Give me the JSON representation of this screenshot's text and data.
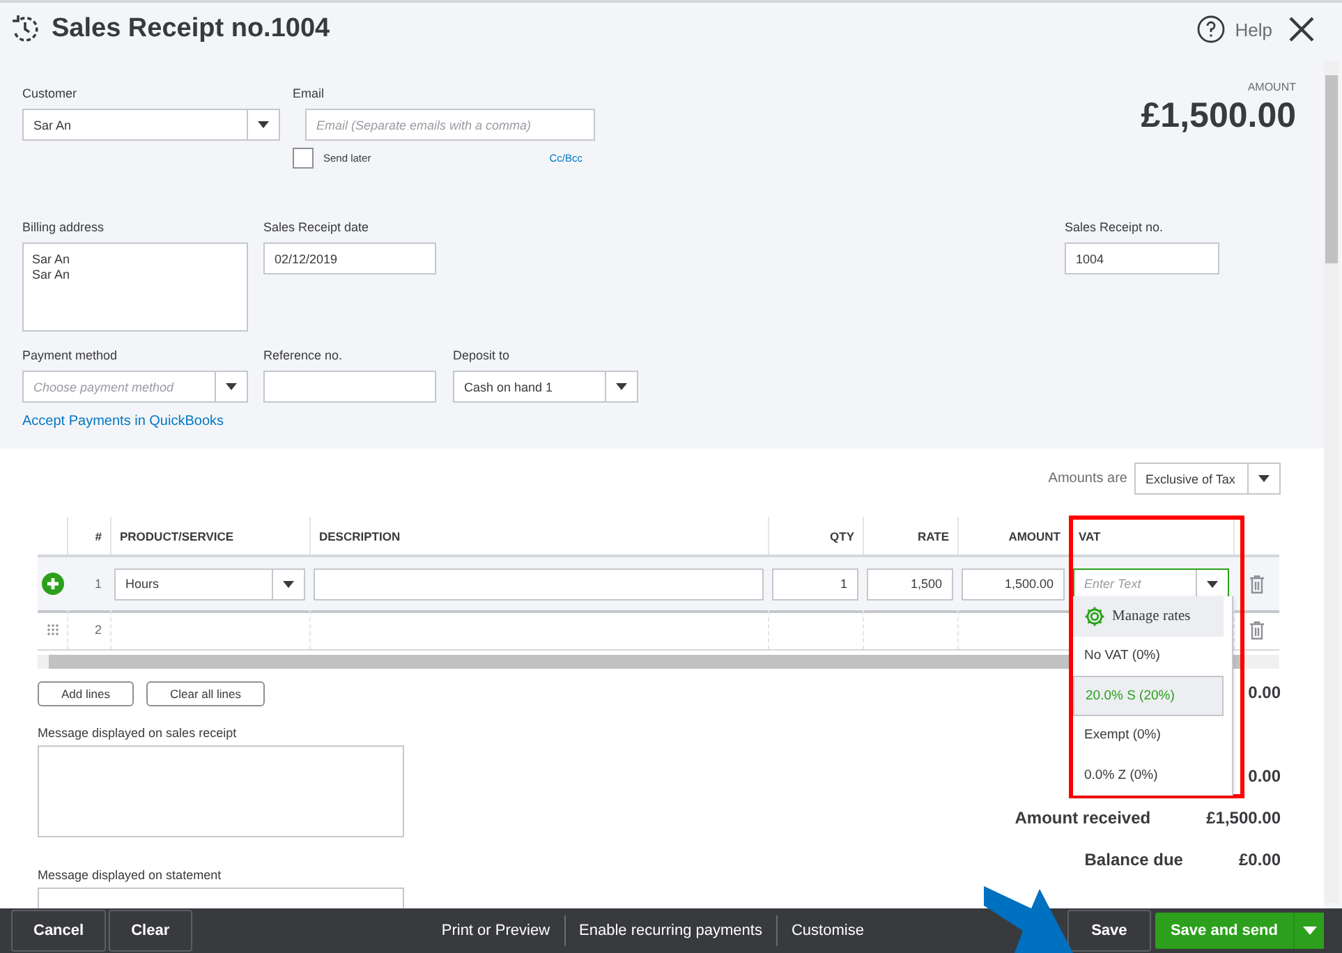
{
  "header": {
    "title": "Sales Receipt no.1004",
    "help": "Help"
  },
  "amount": {
    "label": "AMOUNT",
    "value": "£1,500.00"
  },
  "customer": {
    "label": "Customer",
    "value": "Sar An"
  },
  "email": {
    "label": "Email",
    "placeholder": "Email (Separate emails with a comma)"
  },
  "send_later": {
    "label": "Send later",
    "checked": false
  },
  "cc_bcc": "Cc/Bcc",
  "billing_address": {
    "label": "Billing address",
    "lines": [
      "Sar An",
      "Sar An"
    ]
  },
  "receipt_date": {
    "label": "Sales Receipt date",
    "value": "02/12/2019"
  },
  "receipt_no": {
    "label": "Sales Receipt no.",
    "value": "1004"
  },
  "payment_method": {
    "label": "Payment method",
    "placeholder": "Choose payment method"
  },
  "reference_no": {
    "label": "Reference no."
  },
  "deposit_to": {
    "label": "Deposit to",
    "value": "Cash on hand 1"
  },
  "accept_payments_link": "Accept Payments in QuickBooks",
  "amounts_are": {
    "label": "Amounts are",
    "value": "Exclusive of Tax"
  },
  "table": {
    "columns": [
      "#",
      "PRODUCT/SERVICE",
      "DESCRIPTION",
      "QTY",
      "RATE",
      "AMOUNT",
      "VAT"
    ],
    "rows": [
      {
        "number": "1",
        "active": true,
        "product": "Hours",
        "qty": "1",
        "rate": "1,500",
        "amount": "1,500.00",
        "vat_placeholder": "Enter Text"
      },
      {
        "number": "2",
        "active": false
      }
    ]
  },
  "vat_menu": [
    {
      "kind": "action",
      "label": "Manage rates",
      "selected": false
    },
    {
      "kind": "option",
      "label": "No VAT (0%)",
      "selected": false
    },
    {
      "kind": "option",
      "label": "20.0% S (20%)",
      "selected": true
    },
    {
      "kind": "option",
      "label": "Exempt (0%)",
      "selected": false
    },
    {
      "kind": "option",
      "label": "0.0% Z (0%)",
      "selected": false
    }
  ],
  "line_buttons": [
    "Add lines",
    "Clear all lines"
  ],
  "messages": [
    {
      "label": "Message displayed on sales receipt"
    },
    {
      "label": "Message displayed on statement"
    }
  ],
  "totals": [
    {
      "value": "0.00"
    },
    {
      "value": "0.00"
    },
    {
      "label": "Amount received",
      "value": "£1,500.00"
    },
    {
      "label": "Balance due",
      "value": "£0.00"
    }
  ],
  "footer": {
    "left": [
      "Cancel",
      "Clear"
    ],
    "center": [
      "Print or Preview",
      "Enable recurring payments",
      "Customise"
    ],
    "save": "Save",
    "save_and_send": "Save and send"
  }
}
